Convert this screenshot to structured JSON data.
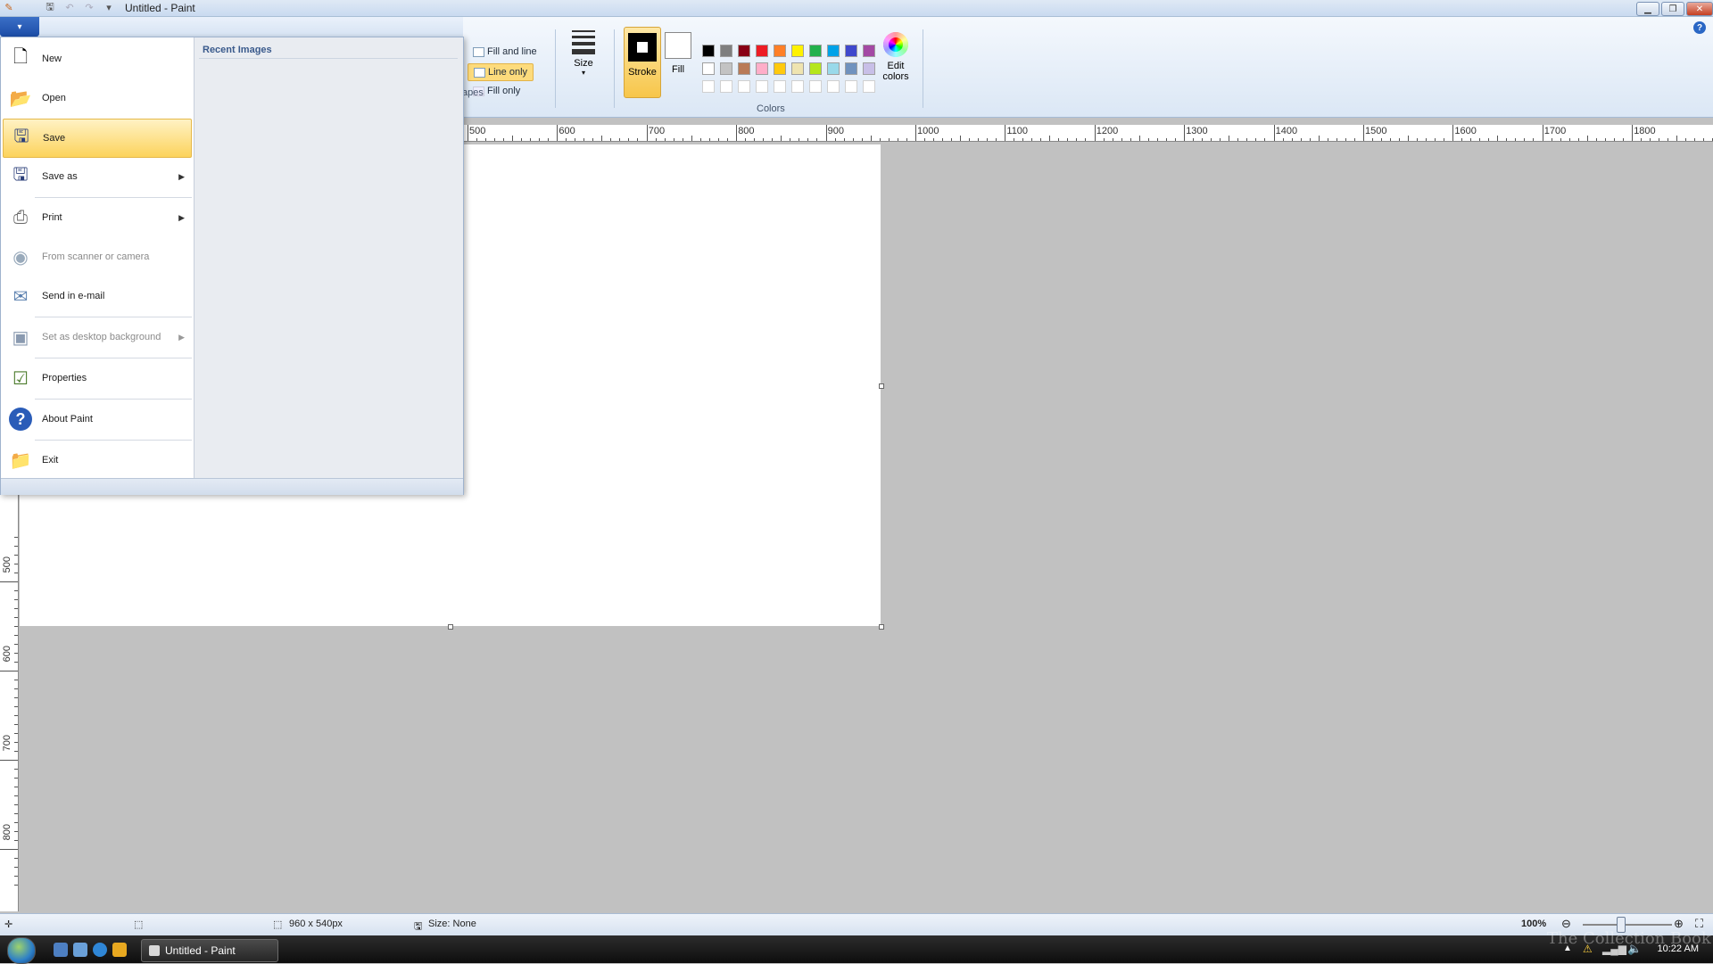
{
  "window": {
    "title": "Untitled - Paint"
  },
  "ribbon": {
    "shapes_options": {
      "fill_and_line": "Fill and line",
      "line_only": "Line only",
      "fill_only": "Fill only"
    },
    "shapes_group_label": "apes",
    "size_label": "Size",
    "stroke_label": "Stroke",
    "fill_label": "Fill",
    "colors_group_label": "Colors",
    "edit_colors_label_1": "Edit",
    "edit_colors_label_2": "colors",
    "palette_row1": [
      "#000000",
      "#7f7f7f",
      "#880015",
      "#ed1c24",
      "#ff7f27",
      "#fff200",
      "#22b14c",
      "#00a2e8",
      "#3f48cc",
      "#a349a4"
    ],
    "palette_row2": [
      "#ffffff",
      "#c3c3c3",
      "#b97a57",
      "#ffaec9",
      "#ffc90e",
      "#efe4b0",
      "#b5e61d",
      "#99d9ea",
      "#7092be",
      "#c8bfe7"
    ]
  },
  "ruler": {
    "h_labels": [
      "500",
      "600",
      "700",
      "800",
      "900",
      "1000",
      "1100",
      "1200",
      "1300",
      "1400",
      "1500",
      "1600",
      "1700",
      "1800"
    ],
    "v_labels": [
      "500",
      "600",
      "700",
      "800"
    ]
  },
  "file_menu": {
    "items": {
      "new": "New",
      "open": "Open",
      "save": "Save",
      "save_as": "Save as",
      "print": "Print",
      "scanner": "From scanner or camera",
      "email": "Send in e-mail",
      "desktop_bg": "Set as desktop background",
      "properties": "Properties",
      "about": "About Paint",
      "exit": "Exit"
    },
    "recent_title": "Recent Images"
  },
  "status": {
    "image_size": "960 x 540px",
    "file_size": "Size: None",
    "zoom": "100%"
  },
  "taskbar": {
    "task_label": "Untitled - Paint",
    "clock": "10:22 AM"
  },
  "watermark": "The Collection Book"
}
